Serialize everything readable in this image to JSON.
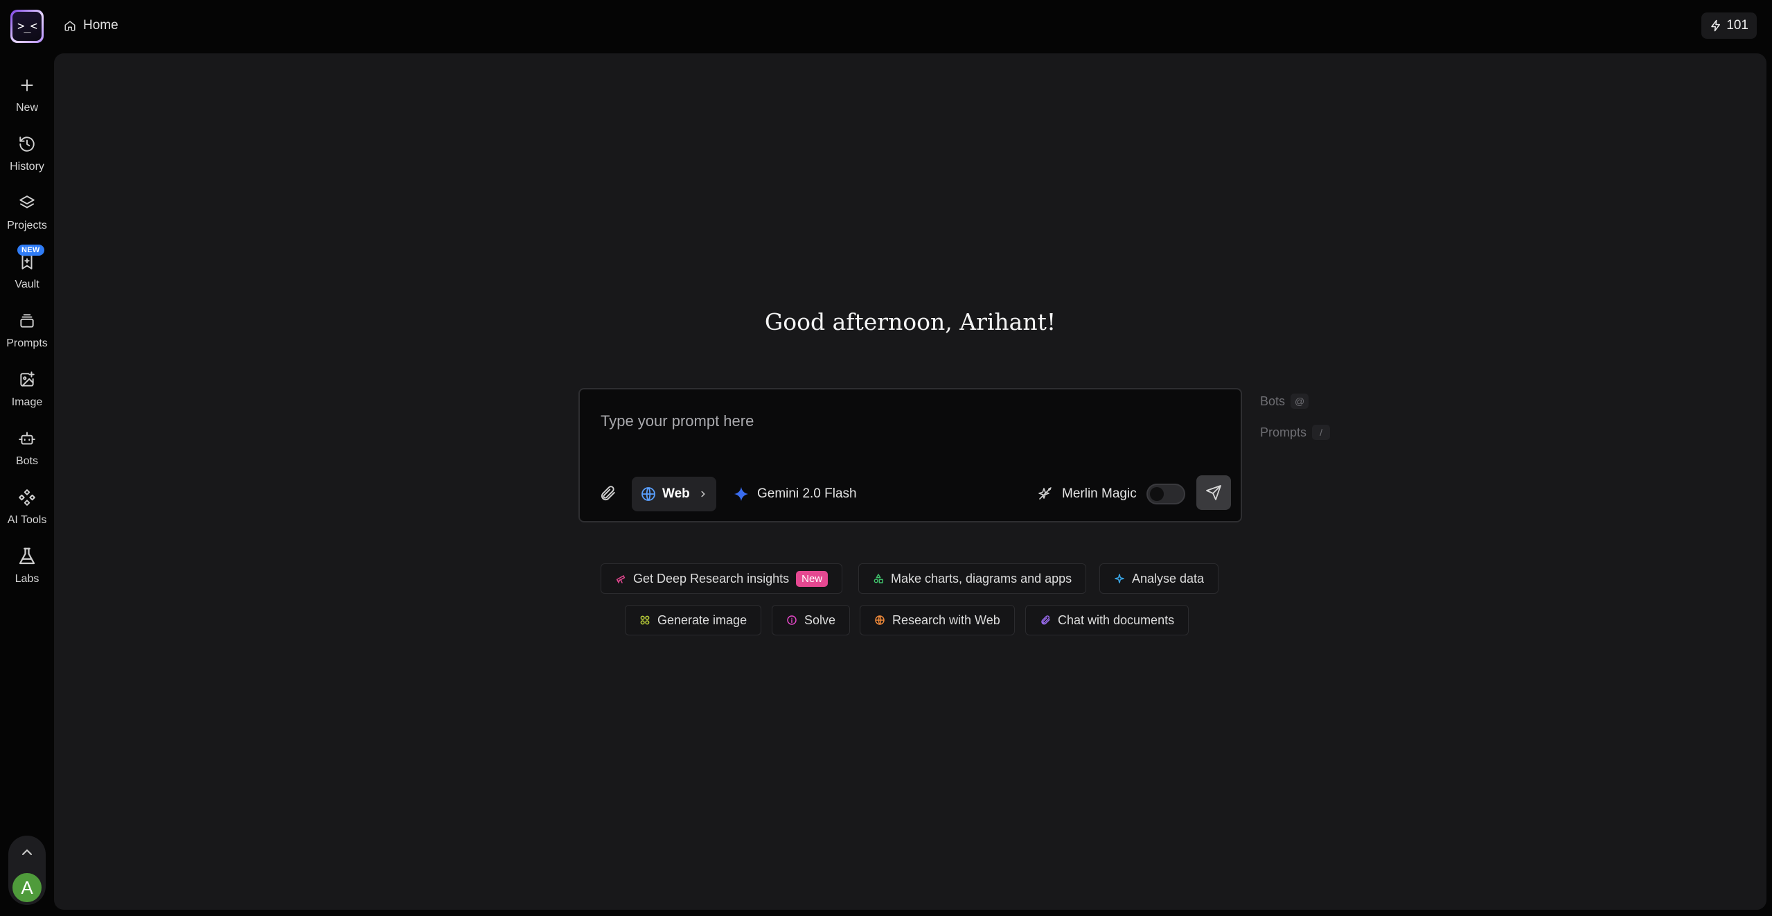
{
  "app": {
    "logo_glyph": ">_<"
  },
  "sidebar": {
    "items": [
      {
        "label": "New",
        "icon": "plus-icon"
      },
      {
        "label": "History",
        "icon": "history-icon"
      },
      {
        "label": "Projects",
        "icon": "layers-icon"
      },
      {
        "label": "Vault",
        "icon": "bookmark-icon",
        "badge": "NEW"
      },
      {
        "label": "Prompts",
        "icon": "stack-icon"
      },
      {
        "label": "Image",
        "icon": "image-add-icon"
      },
      {
        "label": "Bots",
        "icon": "bot-icon"
      },
      {
        "label": "AI Tools",
        "icon": "tools-icon"
      },
      {
        "label": "Labs",
        "icon": "flask-icon"
      }
    ],
    "avatar_initial": "A"
  },
  "header": {
    "breadcrumb": "Home",
    "credits": "101"
  },
  "main": {
    "greeting": "Good afternoon, Arihant!",
    "prompt": {
      "placeholder": "Type your prompt here",
      "value": "",
      "web_label": "Web",
      "model_label": "Gemini 2.0 Flash",
      "magic_label": "Merlin Magic",
      "magic_enabled": false
    },
    "hints": [
      {
        "label": "Bots",
        "key": "@"
      },
      {
        "label": "Prompts",
        "key": "/"
      }
    ],
    "suggestions": [
      {
        "label": "Get Deep Research insights",
        "badge": "New",
        "icon": "telescope-icon"
      },
      {
        "label": "Make charts, diagrams and apps",
        "icon": "shapes-icon"
      },
      {
        "label": "Analyse data",
        "icon": "sparkle-icon"
      },
      {
        "label": "Generate image",
        "icon": "image-grid-icon"
      },
      {
        "label": "Solve",
        "icon": "info-icon"
      },
      {
        "label": "Research with Web",
        "icon": "globe-icon"
      },
      {
        "label": "Chat with documents",
        "icon": "paperclip-icon"
      }
    ]
  },
  "colors": {
    "page_bg": "#050505",
    "panel_bg": "#18181a",
    "accent_blue": "#2f7cf6",
    "accent_pink": "#e54891",
    "avatar_green": "#4f9b3b"
  }
}
